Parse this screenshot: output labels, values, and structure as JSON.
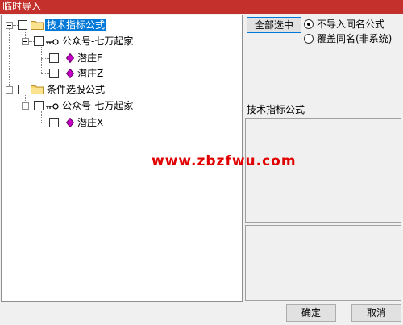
{
  "window": {
    "title": "临时导入"
  },
  "tree": {
    "root1": {
      "label": "技术指标公式"
    },
    "group1": {
      "label": "公众号-七万起家"
    },
    "item1": {
      "label": "潜庄F"
    },
    "item2": {
      "label": "潜庄Z"
    },
    "root2": {
      "label": "条件选股公式"
    },
    "group2": {
      "label": "公众号-七万起家"
    },
    "item3": {
      "label": "潜庄X"
    }
  },
  "options": {
    "select_all_label": "全部选中",
    "radio_skip_label": "不导入同名公式",
    "radio_overwrite_label": "覆盖同名(非系统)",
    "selected": "skip"
  },
  "info": {
    "formula_type": "技术指标公式"
  },
  "watermark": {
    "text": "www.zbzfwu.com"
  },
  "footer": {
    "ok_label": "确定",
    "cancel_label": "取消"
  },
  "colors": {
    "titlebar": "#c4302b",
    "selection": "#0078d7",
    "watermark": "#e00000",
    "gem": "#c800c8"
  },
  "icons": {
    "folder": "folder-icon",
    "key": "key-icon",
    "formula": "gem-icon"
  }
}
